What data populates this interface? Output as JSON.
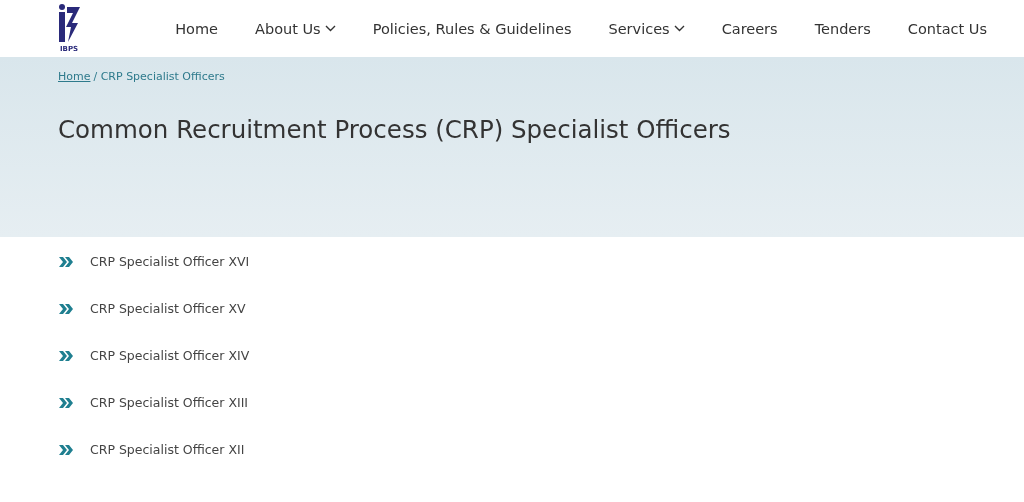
{
  "logo": {
    "text": "IBPS"
  },
  "nav": [
    {
      "label": "Home",
      "dropdown": false
    },
    {
      "label": "About Us",
      "dropdown": true
    },
    {
      "label": "Policies, Rules & Guidelines",
      "dropdown": false
    },
    {
      "label": "Services",
      "dropdown": true
    },
    {
      "label": "Careers",
      "dropdown": false
    },
    {
      "label": "Tenders",
      "dropdown": false
    },
    {
      "label": "Contact Us",
      "dropdown": false
    }
  ],
  "breadcrumb": {
    "link": "Home",
    "current": "/ CRP Specialist Officers"
  },
  "title": "Common Recruitment Process (CRP) Specialist Officers",
  "links": [
    "CRP Specialist Officer XVI",
    "CRP Specialist Officer XV",
    "CRP Specialist Officer XIV",
    "CRP Specialist Officer XIII",
    "CRP Specialist Officer XII"
  ]
}
